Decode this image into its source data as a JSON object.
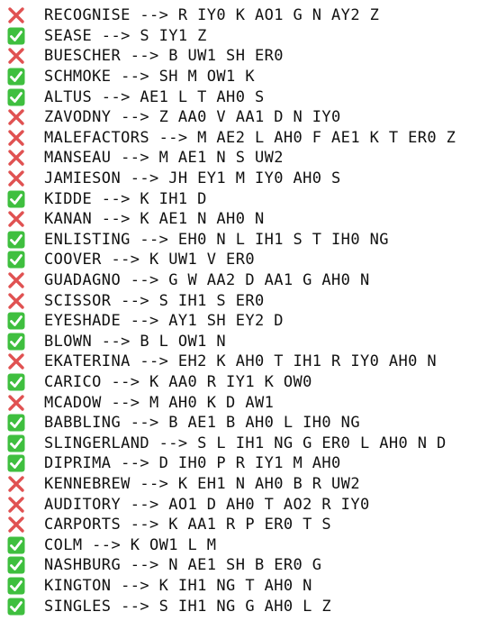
{
  "colors": {
    "correct": "#3fbf3f",
    "incorrect": "#e05252",
    "text": "#111111"
  },
  "icons": {
    "correct": "check-mark-button-icon",
    "incorrect": "cross-mark-icon"
  },
  "rows": [
    {
      "status": "incorrect",
      "text": "RECOGNISE --> R IY0 K AO1 G N AY2 Z"
    },
    {
      "status": "correct",
      "text": "SEASE --> S IY1 Z"
    },
    {
      "status": "incorrect",
      "text": "BUESCHER --> B UW1 SH ER0"
    },
    {
      "status": "correct",
      "text": "SCHMOKE --> SH M OW1 K"
    },
    {
      "status": "correct",
      "text": "ALTUS --> AE1 L T AH0 S"
    },
    {
      "status": "incorrect",
      "text": "ZAVODNY --> Z AA0 V AA1 D N IY0"
    },
    {
      "status": "incorrect",
      "text": "MALEFACTORS --> M AE2 L AH0 F AE1 K T ER0 Z"
    },
    {
      "status": "incorrect",
      "text": "MANSEAU --> M AE1 N S UW2"
    },
    {
      "status": "incorrect",
      "text": "JAMIESON --> JH EY1 M IY0 AH0 S"
    },
    {
      "status": "correct",
      "text": "KIDDE --> K IH1 D"
    },
    {
      "status": "incorrect",
      "text": "KANAN --> K AE1 N AH0 N"
    },
    {
      "status": "correct",
      "text": "ENLISTING --> EH0 N L IH1 S T IH0 NG"
    },
    {
      "status": "correct",
      "text": "COOVER --> K UW1 V ER0"
    },
    {
      "status": "incorrect",
      "text": "GUADAGNO --> G W AA2 D AA1 G AH0 N"
    },
    {
      "status": "incorrect",
      "text": "SCISSOR --> S IH1 S ER0"
    },
    {
      "status": "correct",
      "text": "EYESHADE --> AY1 SH EY2 D"
    },
    {
      "status": "correct",
      "text": "BLOWN --> B L OW1 N"
    },
    {
      "status": "incorrect",
      "text": "EKATERINA --> EH2 K AH0 T IH1 R IY0 AH0 N"
    },
    {
      "status": "correct",
      "text": "CARICO --> K AA0 R IY1 K OW0"
    },
    {
      "status": "incorrect",
      "text": "MCADOW --> M AH0 K D AW1"
    },
    {
      "status": "correct",
      "text": "BABBLING --> B AE1 B AH0 L IH0 NG"
    },
    {
      "status": "correct",
      "text": "SLINGERLAND --> S L IH1 NG G ER0 L AH0 N D"
    },
    {
      "status": "correct",
      "text": "DIPRIMA --> D IH0 P R IY1 M AH0"
    },
    {
      "status": "incorrect",
      "text": "KENNEBREW --> K EH1 N AH0 B R UW2"
    },
    {
      "status": "incorrect",
      "text": "AUDITORY --> AO1 D AH0 T AO2 R IY0"
    },
    {
      "status": "incorrect",
      "text": "CARPORTS --> K AA1 R P ER0 T S"
    },
    {
      "status": "correct",
      "text": "COLM --> K OW1 L M"
    },
    {
      "status": "correct",
      "text": "NASHBURG --> N AE1 SH B ER0 G"
    },
    {
      "status": "correct",
      "text": "KINGTON --> K IH1 NG T AH0 N"
    },
    {
      "status": "correct",
      "text": "SINGLES --> S IH1 NG G AH0 L Z"
    }
  ]
}
